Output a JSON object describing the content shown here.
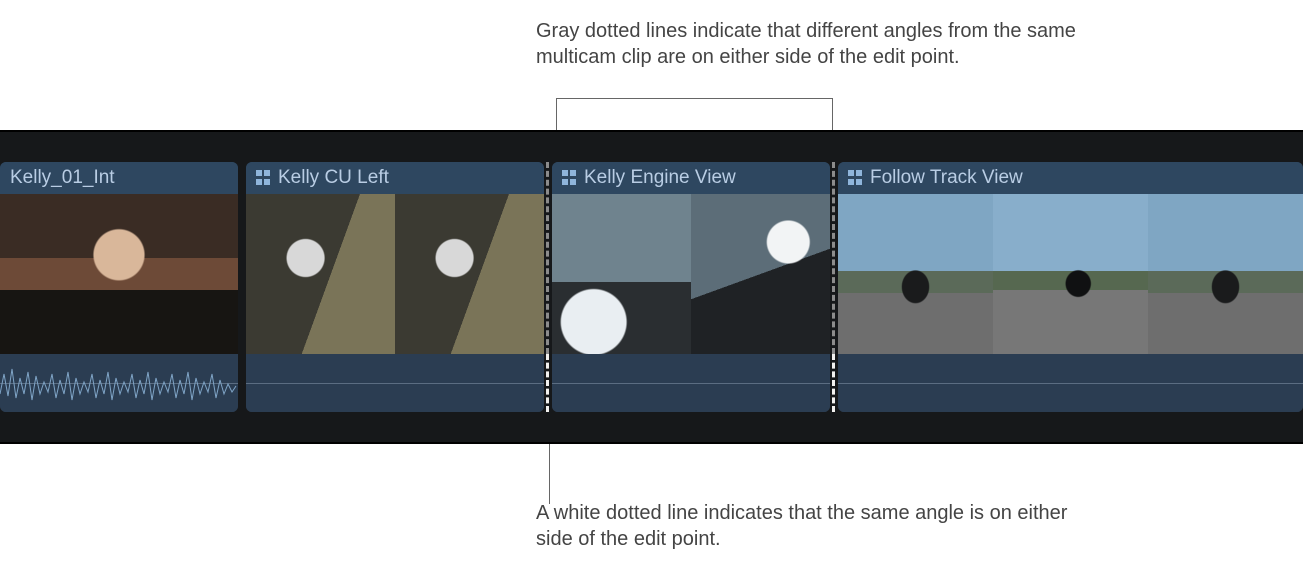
{
  "annotations": {
    "top": "Gray dotted lines indicate that different angles from the same multicam clip are on either side of the edit point.",
    "bottom": "A white dotted line indicates that the same angle is on either side of the edit point."
  },
  "clips": [
    {
      "label": "Kelly_01_Int",
      "multicam": false
    },
    {
      "label": "Kelly CU Left",
      "multicam": true
    },
    {
      "label": "Kelly Engine View",
      "multicam": true
    },
    {
      "label": "Follow Track View",
      "multicam": true
    }
  ],
  "edit_points": [
    {
      "between": [
        "Kelly CU Left",
        "Kelly Engine View"
      ],
      "header_thumb_color": "gray",
      "audio_color": "white"
    },
    {
      "between": [
        "Kelly Engine View",
        "Follow Track View"
      ],
      "header_thumb_color": "gray",
      "audio_color": "white"
    }
  ],
  "colors": {
    "timeline_bg": "#16181a",
    "clip_header_bg": "#2e4760",
    "clip_body_bg": "#2b3d52",
    "clip_text": "#b9cde4",
    "dotted_gray": "#8c8c8c",
    "dotted_white": "#f2f1ef"
  }
}
